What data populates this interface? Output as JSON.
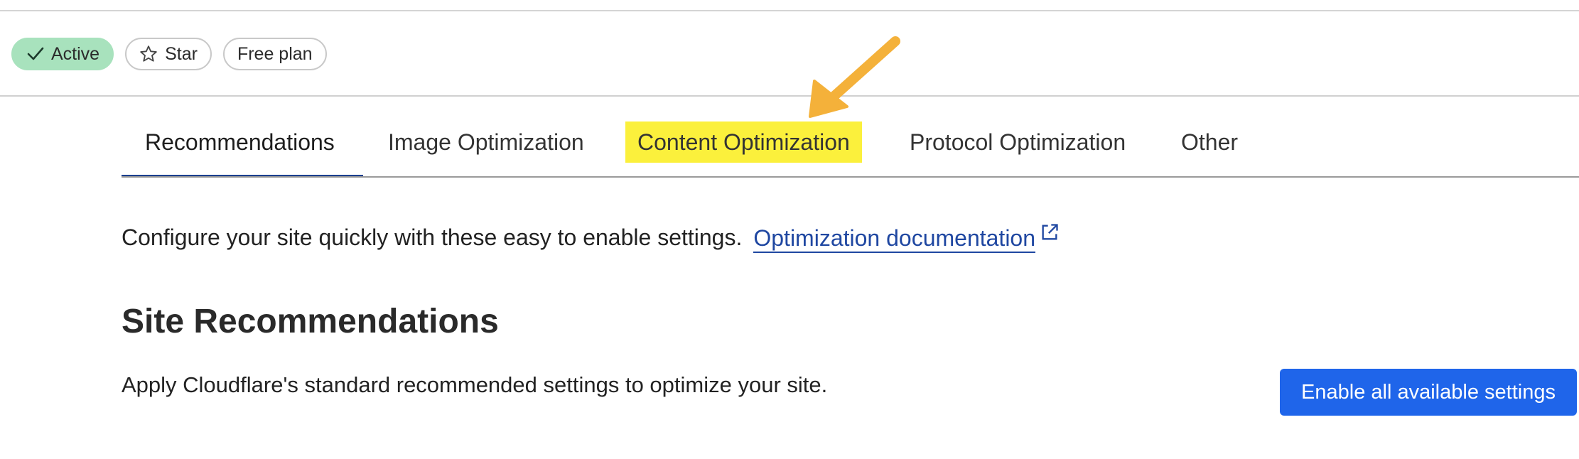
{
  "status_badges": {
    "active": "Active",
    "star": "Star",
    "plan": "Free plan"
  },
  "tabs": [
    {
      "label": "Recommendations",
      "selected": true
    },
    {
      "label": "Image Optimization"
    },
    {
      "label": "Content Optimization",
      "highlighted": true
    },
    {
      "label": "Protocol Optimization"
    },
    {
      "label": "Other"
    }
  ],
  "intro": {
    "text": "Configure your site quickly with these easy to enable settings.",
    "link_label": "Optimization documentation"
  },
  "section": {
    "title": "Site Recommendations",
    "description": "Apply Cloudflare's standard recommended settings to optimize your site.",
    "button_label": "Enable all available settings"
  },
  "icons": {
    "active": "check-icon",
    "star": "star-outline-icon",
    "link": "external-link-icon",
    "annotation": "arrow-annotation"
  },
  "colors": {
    "link": "#1f47a1",
    "primary_button": "#1f65ea",
    "active_badge": "#a8e2bd",
    "highlight": "#fbf03c",
    "annotation_arrow": "#f4b13a",
    "tab_underline": "#1a3f8f"
  }
}
